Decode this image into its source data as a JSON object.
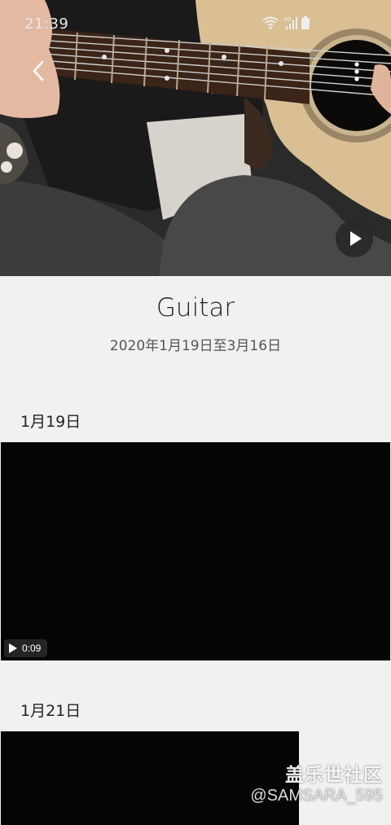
{
  "status_bar": {
    "time": "21:39",
    "network_label": "4G"
  },
  "header": {
    "back_icon": "chevron-left-icon",
    "more_icon": "more-vertical-icon",
    "play_icon": "play-icon"
  },
  "album": {
    "title": "Guitar",
    "date_range": "2020年1月19日至3月16日"
  },
  "sections": [
    {
      "date": "1月19日",
      "items": [
        {
          "type": "video",
          "duration": "0:09"
        }
      ]
    },
    {
      "date": "1月21日",
      "items": [
        {
          "type": "video"
        }
      ]
    }
  ],
  "watermark": {
    "brand": "盖乐世社区",
    "user": "@SAMSARA_595"
  },
  "colors": {
    "page_bg": "#f1f1f1",
    "video_bg": "#050407",
    "text_primary": "#222222",
    "text_secondary": "#555555"
  }
}
